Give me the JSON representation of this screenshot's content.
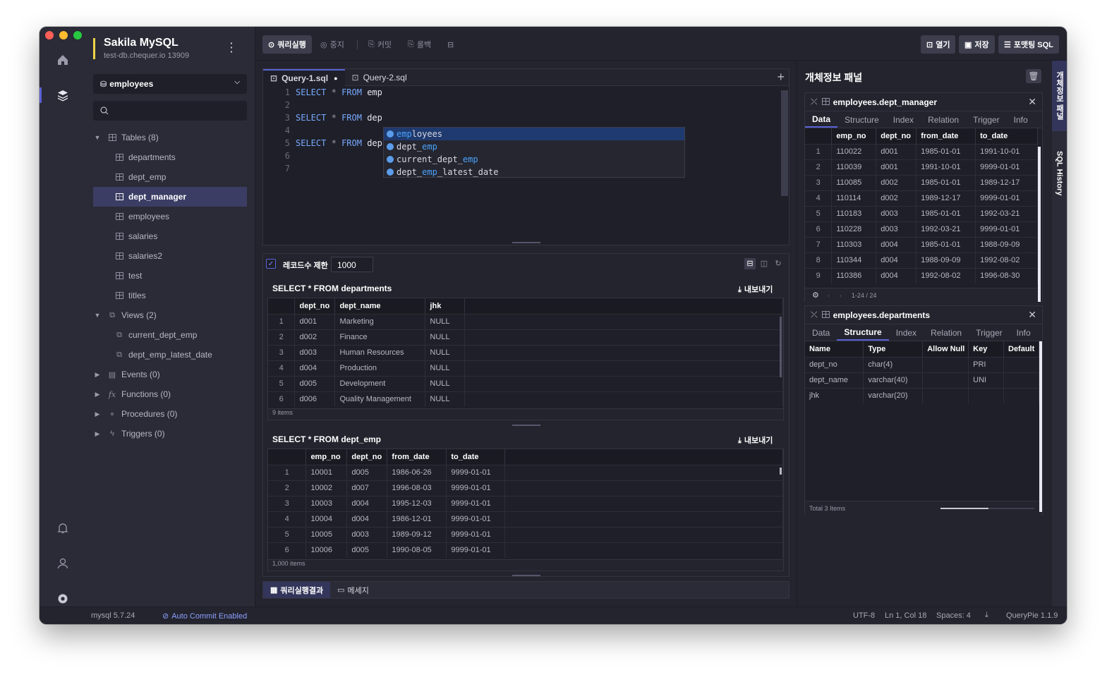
{
  "connection": {
    "name": "Sakila MySQL",
    "host": "test-db.chequer.io  13909",
    "menu_icon": "more-vertical-icon"
  },
  "sidebar": {
    "database": "employees",
    "tables_label": "Tables (8)",
    "tables": [
      "departments",
      "dept_emp",
      "dept_manager",
      "employees",
      "salaries",
      "salaries2",
      "test",
      "titles"
    ],
    "selected_table": "dept_manager",
    "views_label": "Views (2)",
    "views": [
      "current_dept_emp",
      "dept_emp_latest_date"
    ],
    "events_label": "Events (0)",
    "functions_label": "Functions (0)",
    "procedures_label": "Procedures (0)",
    "triggers_label": "Triggers (0)"
  },
  "toolbar": {
    "run": "쿼리실행",
    "stop": "중지",
    "commit": "커밋",
    "rollback": "롤백",
    "open": "열기",
    "save": "저장",
    "format": "포맷팅 SQL"
  },
  "editor": {
    "tabs": [
      "Query-1.sql",
      "Query-2.sql"
    ],
    "lines": [
      {
        "n": "1",
        "kw1": "SELECT",
        "op": "*",
        "kw2": "FROM",
        "rest": "emp"
      },
      {
        "n": "2",
        "kw1": "",
        "op": "",
        "kw2": "",
        "rest": ""
      },
      {
        "n": "3",
        "kw1": "SELECT",
        "op": "*",
        "kw2": "FROM",
        "rest": "dep"
      },
      {
        "n": "4",
        "kw1": "",
        "op": "",
        "kw2": "",
        "rest": ""
      },
      {
        "n": "5",
        "kw1": "SELECT",
        "op": "*",
        "kw2": "FROM",
        "rest": "dep"
      },
      {
        "n": "6",
        "kw1": "",
        "op": "",
        "kw2": "",
        "rest": ""
      },
      {
        "n": "7",
        "kw1": "",
        "op": "",
        "kw2": "",
        "rest": ""
      }
    ],
    "autocomplete": [
      {
        "pre": "",
        "hl": "emp",
        "post": "loyees"
      },
      {
        "pre": "dept_",
        "hl": "emp",
        "post": ""
      },
      {
        "pre": "current_dept_",
        "hl": "emp",
        "post": ""
      },
      {
        "pre": "dept_",
        "hl": "emp",
        "post": "_latest_date"
      }
    ]
  },
  "results": {
    "limit_label": "레코드수 제한",
    "limit_value": "1000",
    "export_label": "내보내기",
    "r1": {
      "title": "SELECT * FROM departments",
      "columns": [
        "dept_no",
        "dept_name",
        "jhk"
      ],
      "rows": [
        [
          "1",
          "d001",
          "Marketing",
          "NULL"
        ],
        [
          "2",
          "d002",
          "Finance",
          "NULL"
        ],
        [
          "3",
          "d003",
          "Human Resources",
          "NULL"
        ],
        [
          "4",
          "d004",
          "Production",
          "NULL"
        ],
        [
          "5",
          "d005",
          "Development",
          "NULL"
        ],
        [
          "6",
          "d006",
          "Quality Management",
          "NULL"
        ]
      ],
      "footer": "9 items"
    },
    "r2": {
      "title": "SELECT * FROM dept_emp",
      "columns": [
        "emp_no",
        "dept_no",
        "from_date",
        "to_date"
      ],
      "rows": [
        [
          "1",
          "10001",
          "d005",
          "1986-06-26",
          "9999-01-01"
        ],
        [
          "2",
          "10002",
          "d007",
          "1996-08-03",
          "9999-01-01"
        ],
        [
          "3",
          "10003",
          "d004",
          "1995-12-03",
          "9999-01-01"
        ],
        [
          "4",
          "10004",
          "d004",
          "1986-12-01",
          "9999-01-01"
        ],
        [
          "5",
          "10005",
          "d003",
          "1989-09-12",
          "9999-01-01"
        ],
        [
          "6",
          "10006",
          "d005",
          "1990-08-05",
          "9999-01-01"
        ]
      ],
      "footer": "1,000 items"
    },
    "bottom_tabs": [
      "쿼리실행결과",
      "메세지"
    ]
  },
  "object_panel": {
    "title": "개체정보 패널",
    "card1": {
      "title": "employees.dept_manager",
      "tabs": [
        "Data",
        "Structure",
        "Index",
        "Relation",
        "Trigger",
        "Info"
      ],
      "active_tab": "Data",
      "columns": [
        "emp_no",
        "dept_no",
        "from_date",
        "to_date"
      ],
      "rows": [
        [
          "1",
          "110022",
          "d001",
          "1985-01-01",
          "1991-10-01"
        ],
        [
          "2",
          "110039",
          "d001",
          "1991-10-01",
          "9999-01-01"
        ],
        [
          "3",
          "110085",
          "d002",
          "1985-01-01",
          "1989-12-17"
        ],
        [
          "4",
          "110114",
          "d002",
          "1989-12-17",
          "9999-01-01"
        ],
        [
          "5",
          "110183",
          "d003",
          "1985-01-01",
          "1992-03-21"
        ],
        [
          "6",
          "110228",
          "d003",
          "1992-03-21",
          "9999-01-01"
        ],
        [
          "7",
          "110303",
          "d004",
          "1985-01-01",
          "1988-09-09"
        ],
        [
          "8",
          "110344",
          "d004",
          "1988-09-09",
          "1992-08-02"
        ],
        [
          "9",
          "110386",
          "d004",
          "1992-08-02",
          "1996-08-30"
        ]
      ],
      "pager": "1-24 / 24"
    },
    "card2": {
      "title": "employees.departments",
      "tabs": [
        "Data",
        "Structure",
        "Index",
        "Relation",
        "Trigger",
        "Info"
      ],
      "active_tab": "Structure",
      "columns": [
        "Name",
        "Type",
        "Allow Null",
        "Key",
        "Default"
      ],
      "rows": [
        [
          "dept_no",
          "char(4)",
          "",
          "PRI",
          ""
        ],
        [
          "dept_name",
          "varchar(40)",
          "",
          "UNI",
          ""
        ],
        [
          "jhk",
          "varchar(20)",
          "",
          "",
          ""
        ]
      ],
      "footer": "Total 3 Items"
    },
    "side_tabs": [
      "개체정보 패널",
      "SQL History"
    ]
  },
  "status": {
    "version": "mysql 5.7.24",
    "autocommit": "Auto Commit Enabled",
    "encoding": "UTF-8",
    "position": "Ln 1, Col 18",
    "spaces": "Spaces: 4",
    "app_version": "QueryPie 1.1.9"
  },
  "colors": {
    "accent": "#5a62d4",
    "highlight": "#4aa3ff",
    "keyword": "#78a9ff",
    "conn_marker": "#f1d44a"
  }
}
